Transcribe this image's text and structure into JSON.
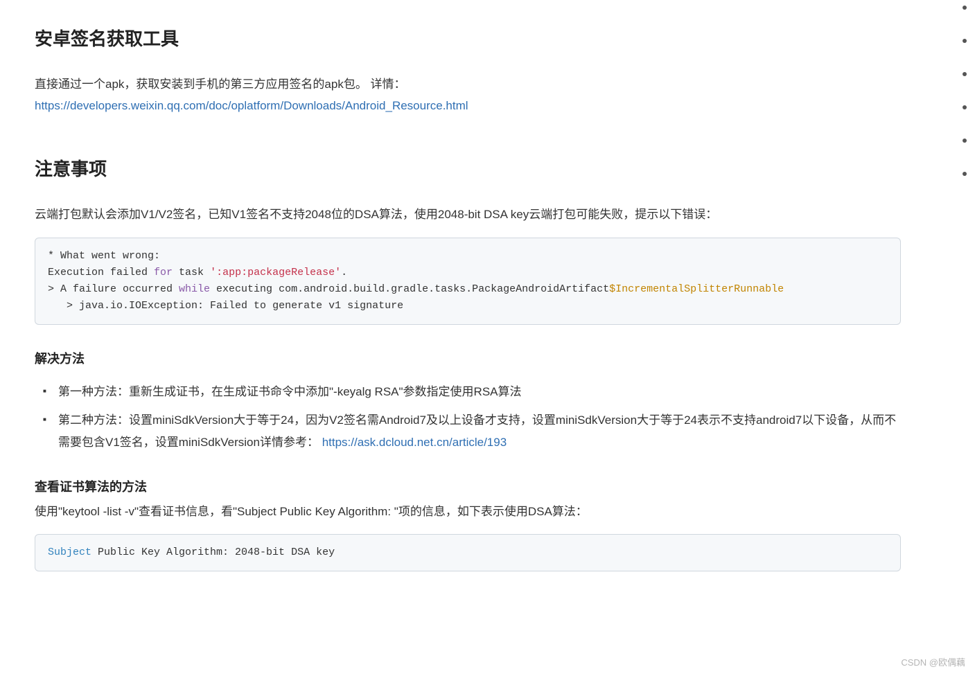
{
  "section1": {
    "heading": "安卓签名获取工具",
    "intro": "直接通过一个apk，获取安装到手机的第三方应用签名的apk包。 详情：",
    "link": "https://developers.weixin.qq.com/doc/oplatform/Downloads/Android_Resource.html"
  },
  "section2": {
    "heading": "注意事项",
    "intro": "云端打包默认会添加V1/V2签名，已知V1签名不支持2048位的DSA算法，使用2048-bit DSA key云端打包可能失败，提示以下错误："
  },
  "code1": {
    "l1a": "* What went wrong:",
    "l2a": "Execution failed ",
    "l2b": "for",
    "l2c": " task ",
    "l2d": "':app:packageRelease'",
    "l2e": ".",
    "l3a": "> A failure occurred ",
    "l3b": "while",
    "l3c": " executing com.android.build.gradle.tasks.PackageAndroidArtifact",
    "l3d": "$IncrementalSplitterRunnable",
    "l4a": "   > java.io.IOException: Failed to generate v1 signature"
  },
  "solution": {
    "heading": "解决方法",
    "item1": "第一种方法：重新生成证书，在生成证书命令中添加\"-keyalg RSA\"参数指定使用RSA算法",
    "item2a": "第二种方法：设置miniSdkVersion大于等于24，因为V2签名需Android7及以上设备才支持，设置miniSdkVersion大于等于24表示不支持android7以下设备，从而不需要包含V1签名，设置miniSdkVersion详情参考： ",
    "item2link": "https://ask.dcloud.net.cn/article/193"
  },
  "check": {
    "heading": "查看证书算法的方法",
    "intro": "使用\"keytool -list -v\"查看证书信息，看\"Subject Public Key Algorithm: \"项的信息，如下表示使用DSA算法："
  },
  "code2": {
    "a": "Subject",
    "b": " Public Key Algorithm: 2048-bit DSA key"
  },
  "watermark": "CSDN @欧偶藕"
}
